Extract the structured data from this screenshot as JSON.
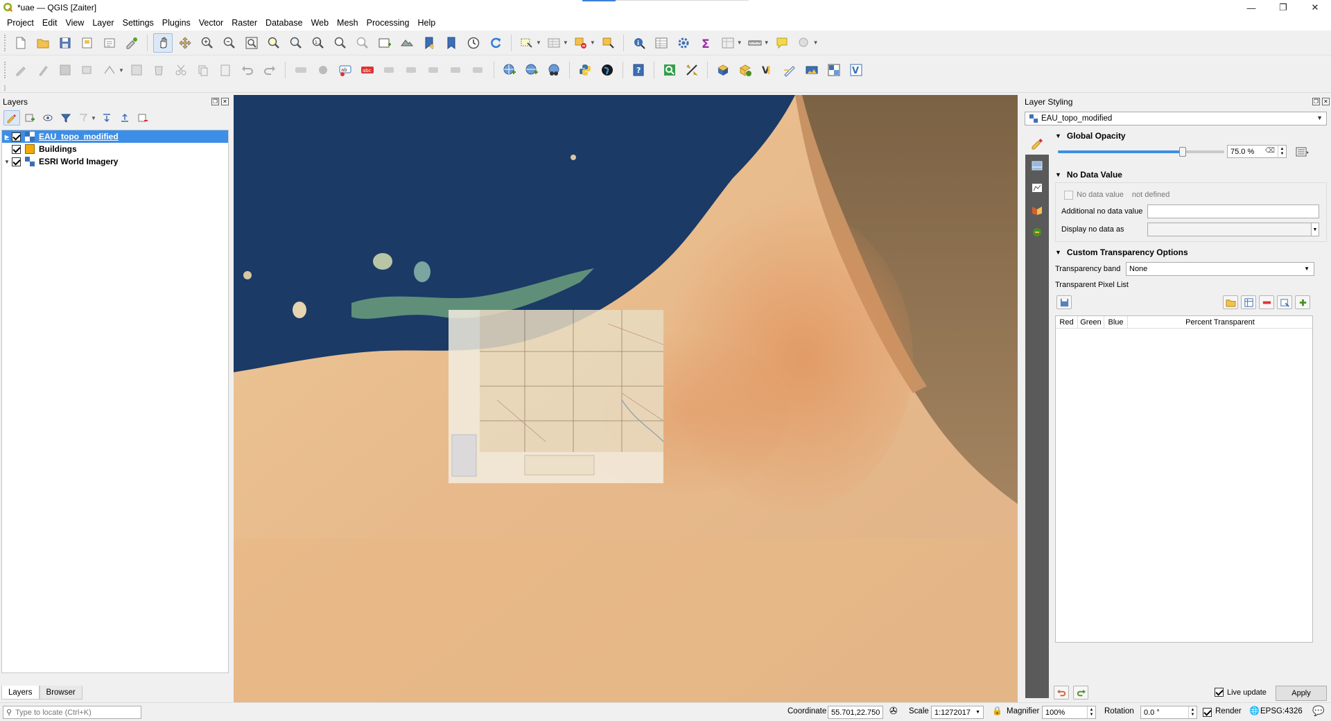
{
  "window": {
    "title": "*uae — QGIS [Zaiter]",
    "controls": {
      "minimize": "—",
      "restore": "❐",
      "close": "✕"
    }
  },
  "menubar": [
    "Project",
    "Edit",
    "View",
    "Layer",
    "Settings",
    "Plugins",
    "Vector",
    "Raster",
    "Database",
    "Web",
    "Mesh",
    "Processing",
    "Help"
  ],
  "layers_panel": {
    "title": "Layers",
    "layers": [
      {
        "name": "EAU_topo_modified",
        "checked": true,
        "selected": true,
        "icon": "raster-layer-icon"
      },
      {
        "name": "Buildings",
        "checked": true,
        "selected": false,
        "icon": "polygon-layer-icon"
      },
      {
        "name": "ESRI World Imagery",
        "checked": true,
        "selected": false,
        "icon": "raster-layer-icon"
      }
    ],
    "tabs": [
      "Layers",
      "Browser"
    ]
  },
  "styling_panel": {
    "title": "Layer Styling",
    "layer_combo": "EAU_topo_modified",
    "global_opacity": {
      "header": "Global Opacity",
      "value_text": "75.0 %",
      "value": 0.75
    },
    "no_data": {
      "header": "No Data Value",
      "no_data_label": "No data value",
      "no_data_status": "not defined",
      "additional_label": "Additional no data value",
      "additional_value": "",
      "display_label": "Display no data as",
      "display_value": ""
    },
    "transparency": {
      "header": "Custom Transparency Options",
      "band_label": "Transparency band",
      "band_value": "None",
      "pixel_list_label": "Transparent Pixel List",
      "columns": [
        "Red",
        "Green",
        "Blue",
        "Percent Transparent"
      ]
    },
    "live_update_label": "Live update",
    "live_update": true,
    "apply_label": "Apply"
  },
  "statusbar": {
    "locate_placeholder": "Type to locate (Ctrl+K)",
    "coordinate_label": "Coordinate",
    "coordinate_value": "55.701,22.750",
    "scale_label": "Scale",
    "scale_value": "1:1272017",
    "magnifier_label": "Magnifier",
    "magnifier_value": "100%",
    "rotation_label": "Rotation",
    "rotation_value": "0.0 °",
    "render_label": "Render",
    "crs": "EPSG:4326"
  }
}
